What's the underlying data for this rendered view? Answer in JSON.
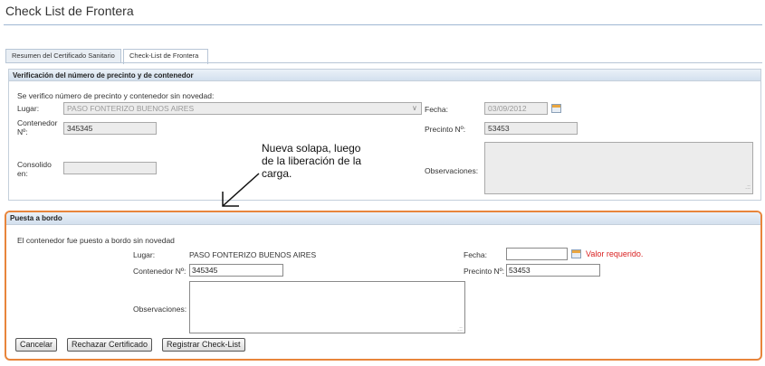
{
  "page": {
    "title": "Check List de Frontera"
  },
  "tabs": [
    {
      "label": "Resumen del Certificado Sanitario",
      "active": false
    },
    {
      "label": "Check-List de Frontera",
      "active": true
    }
  ],
  "verificacion": {
    "header": "Verificación del número de precinto y de contenedor",
    "status_text": "Se verifico número de precinto y contenedor sin novedad:",
    "lugar_label": "Lugar:",
    "lugar_value": "PASO FONTERIZO BUENOS AIRES",
    "fecha_label": "Fecha:",
    "fecha_value": "03/09/2012",
    "contenedor_label_line1": "Contenedor",
    "contenedor_label_line2": "Nº:",
    "contenedor_value": "345345",
    "precinto_label": "Precinto Nº:",
    "precinto_value": "53453",
    "consolido_label_line1": "Consolido",
    "consolido_label_line2": "en:",
    "consolido_value": "",
    "observaciones_label": "Observaciones:"
  },
  "annotation": {
    "line1": "Nueva solapa, luego",
    "line2": "de la liberación de la",
    "line3": "carga."
  },
  "puesta_a_bordo": {
    "header": "Puesta a bordo",
    "status_text": "El contenedor fue puesto a bordo sin novedad",
    "lugar_label": "Lugar:",
    "lugar_value": "PASO FONTERIZO BUENOS AIRES",
    "fecha_label": "Fecha:",
    "fecha_value": "",
    "fecha_error": "Valor requerido.",
    "contenedor_label": "Contenedor Nº:",
    "contenedor_value": "345345",
    "precinto_label": "Precinto Nº:",
    "precinto_value": "53453",
    "observaciones_label": "Observaciones:"
  },
  "buttons": {
    "cancelar": "Cancelar",
    "rechazar": "Rechazar Certificado",
    "registrar": "Registrar Check-List"
  },
  "colors": {
    "highlight_border": "#e8853b",
    "error_text": "#d92020",
    "header_gradient": "#d3e0ee"
  }
}
